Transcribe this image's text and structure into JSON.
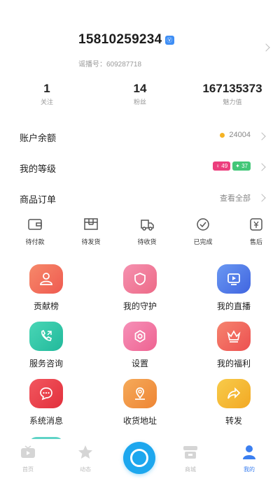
{
  "profile": {
    "phone": "15810259234",
    "badge": "Ⓥ",
    "uid": "谣播号：609287718"
  },
  "stats": [
    {
      "value": "1",
      "label": "关注"
    },
    {
      "value": "14",
      "label": "粉丝"
    },
    {
      "value": "167135373",
      "label": "魅力值"
    }
  ],
  "rows": {
    "balance": {
      "label": "账户余额",
      "value": "24004"
    },
    "level": {
      "label": "我的等级",
      "badge1": "♀ 49",
      "badge2": "✦ 37"
    },
    "orders": {
      "label": "商品订单",
      "value": "查看全部"
    }
  },
  "order_status": [
    {
      "label": "待付款",
      "icon": "wallet-icon"
    },
    {
      "label": "待发货",
      "icon": "package-icon"
    },
    {
      "label": "待收货",
      "icon": "truck-icon"
    },
    {
      "label": "已完成",
      "icon": "check-circle-icon"
    },
    {
      "label": "售后",
      "icon": "refund-icon"
    }
  ],
  "menu": [
    {
      "label": "贡献榜",
      "icon": "user-icon",
      "color": "#f2725a"
    },
    {
      "label": "我的守护",
      "icon": "shield-icon",
      "color": "#f07a9a"
    },
    {
      "label": "我的直播",
      "icon": "tv-icon",
      "color": "#4f7be8"
    },
    {
      "label": "服务咨询",
      "icon": "phone-icon",
      "color": "#2fc7a8"
    },
    {
      "label": "设置",
      "icon": "gear-icon",
      "color": "#f277a2"
    },
    {
      "label": "我的福利",
      "icon": "crown-icon",
      "color": "#f26a5e"
    },
    {
      "label": "系统消息",
      "icon": "message-icon",
      "color": "#ee4550"
    },
    {
      "label": "收货地址",
      "icon": "location-icon",
      "color": "#f09a48"
    },
    {
      "label": "转发",
      "icon": "share-icon",
      "color": "#f6bf34"
    }
  ],
  "tabs": [
    {
      "label": "首页",
      "icon": "home-tv-icon"
    },
    {
      "label": "动态",
      "icon": "star-icon"
    },
    {
      "label": "",
      "icon": "live-center-icon"
    },
    {
      "label": "商城",
      "icon": "store-icon"
    },
    {
      "label": "我的",
      "icon": "me-icon",
      "active": true
    }
  ],
  "colors": {
    "accent": "#1da7ee",
    "active_tab": "#3b7ff0"
  }
}
